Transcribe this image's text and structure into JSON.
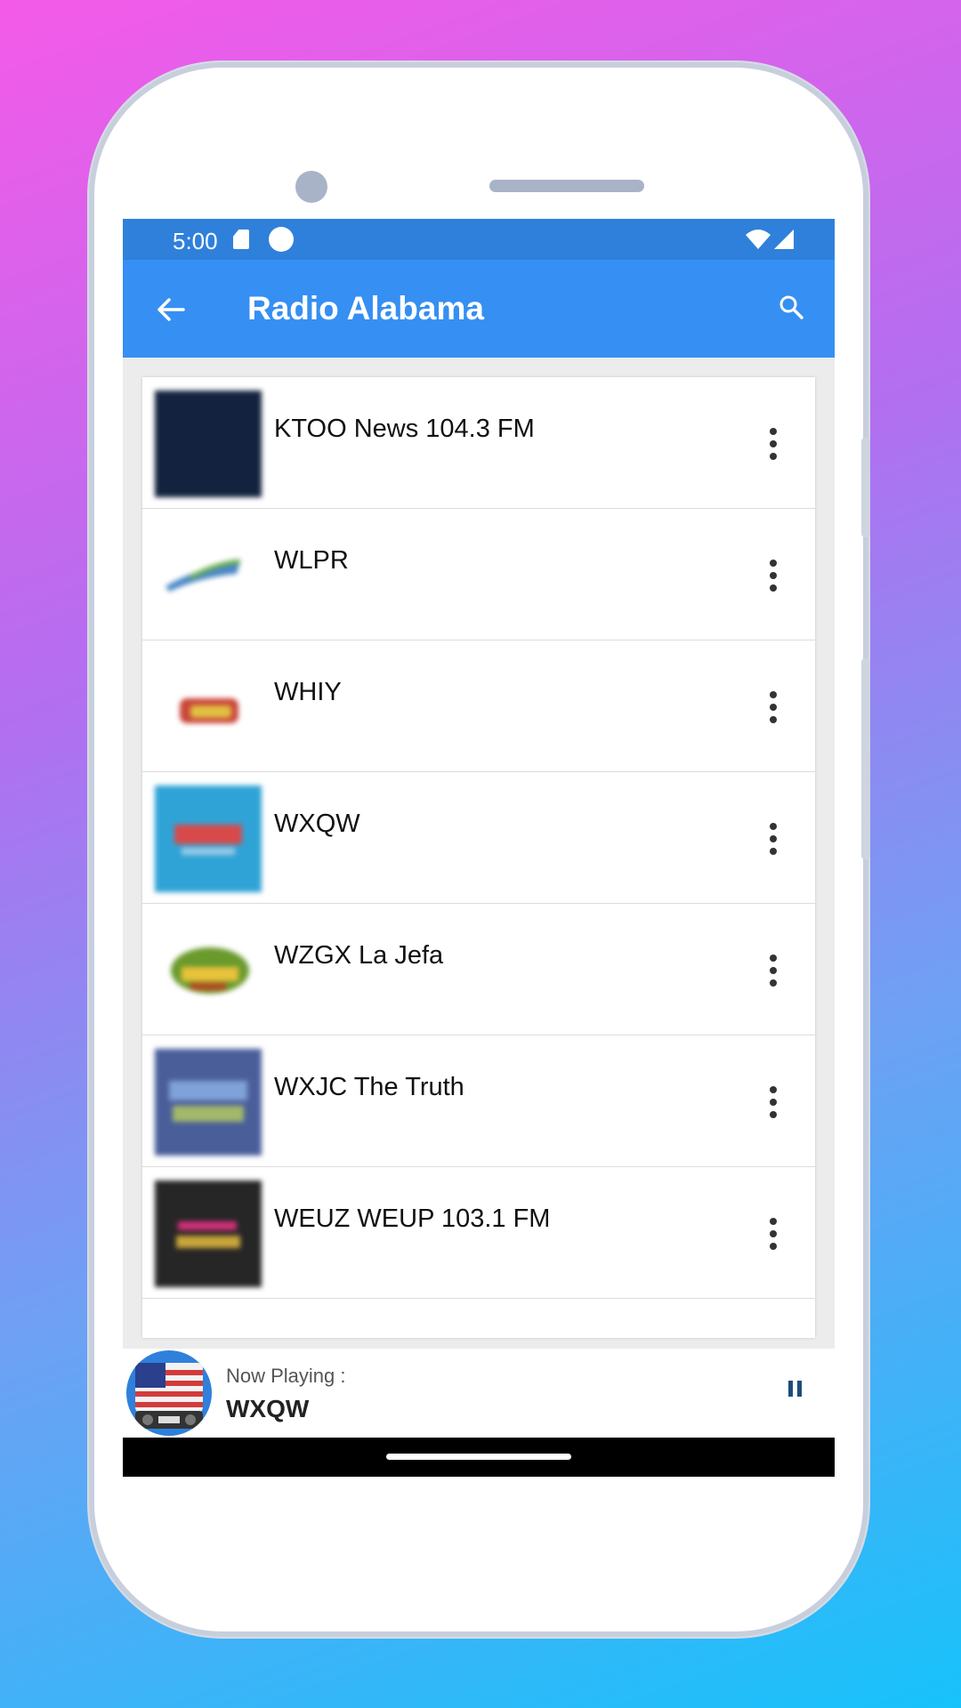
{
  "status_bar": {
    "time": "5:00"
  },
  "app_bar": {
    "title": "Radio Alabama"
  },
  "stations": [
    {
      "name": "KTOO News 104.3 FM",
      "logo_color": "#13233f"
    },
    {
      "name": "WLPR",
      "logo_color": "#4a86c6"
    },
    {
      "name": "WHIY",
      "logo_color": "#c9463a"
    },
    {
      "name": "WXQW",
      "logo_color": "#2fa3d6"
    },
    {
      "name": "WZGX La Jefa",
      "logo_color": "#6a9a2c"
    },
    {
      "name": "WXJC The Truth",
      "logo_color": "#4a5e9a"
    },
    {
      "name": "WEUZ WEUP 103.1 FM",
      "logo_color": "#262626"
    }
  ],
  "now_playing": {
    "label": "Now Playing :",
    "station": "WXQW"
  },
  "colors": {
    "status_bar": "#2f80db",
    "app_bar": "#368ff2",
    "pause": "#1d4d7a"
  }
}
